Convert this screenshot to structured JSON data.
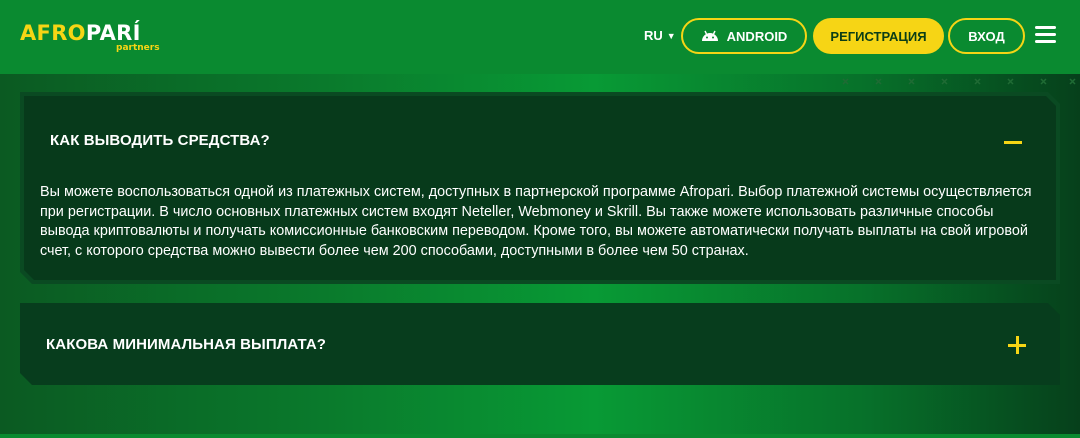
{
  "header": {
    "logo": {
      "part1": "AFRO",
      "part2": "PARÍ",
      "sub": "partners"
    },
    "language": "RU",
    "android_label": "ANDROID",
    "register_label": "РЕГИСТРАЦИЯ",
    "login_label": "ВХОД"
  },
  "colors": {
    "accent": "#f6d515",
    "header_bg": "#0a8a30",
    "panel_bg": "#073d1d"
  },
  "faq": [
    {
      "question": "КАК ВЫВОДИТЬ СРЕДСТВА?",
      "expanded": true,
      "toggle_icon": "minus-icon",
      "answer": "Вы можете воспользоваться одной из платежных систем, доступных в партнерской программе Afropari. Выбор платежной системы осуществляется при регистрации. В число основных платежных систем входят Neteller, Webmoney и Skrill. Вы также можете использовать различные способы вывода криптовалюты и получать комиссионные банковским переводом. Кроме того, вы можете автоматически получать выплаты на свой игровой счет, с которого средства можно вывести более чем 200 способами, доступными в более чем 50 странах."
    },
    {
      "question": "КАКОВА МИНИМАЛЬНАЯ ВЫПЛАТА?",
      "expanded": false,
      "toggle_icon": "plus-icon"
    }
  ]
}
